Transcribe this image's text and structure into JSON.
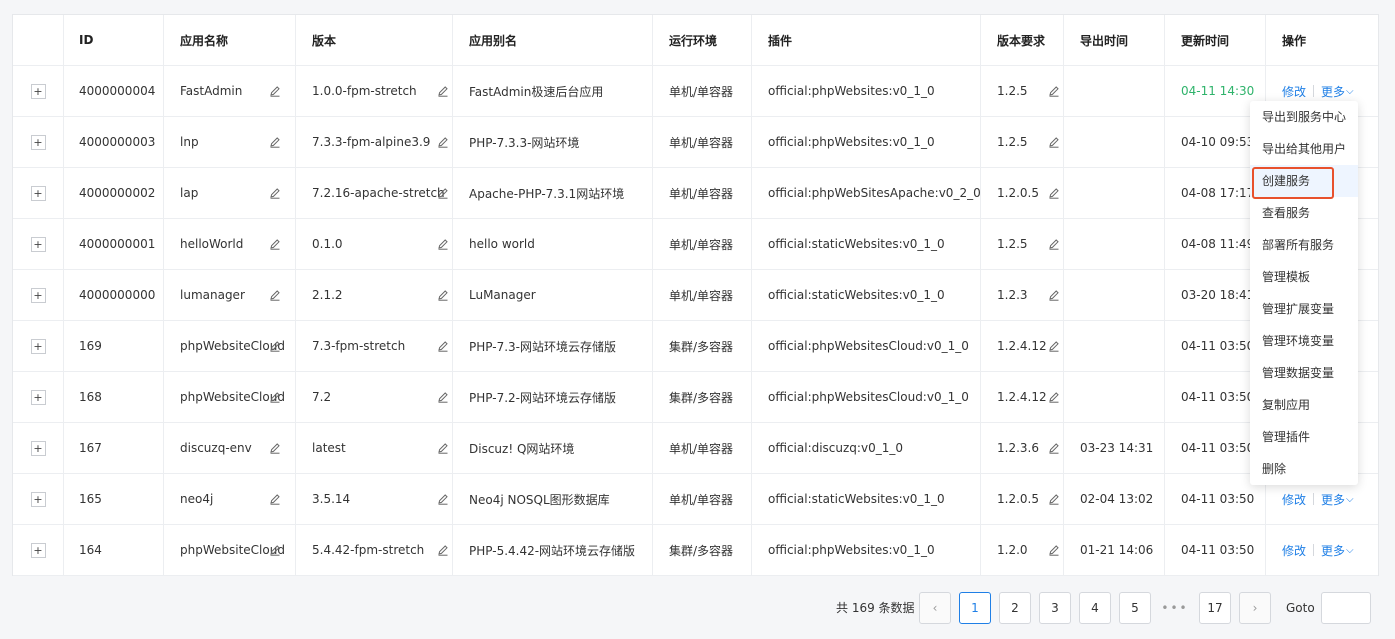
{
  "columns": [
    "",
    "ID",
    "应用名称",
    "版本",
    "应用别名",
    "运行环境",
    "插件",
    "版本要求",
    "导出时间",
    "更新时间",
    "操作"
  ],
  "rows": [
    {
      "id": "4000000004",
      "name": "FastAdmin",
      "version": "1.0.0-fpm-stretch",
      "alias": "FastAdmin极速后台应用",
      "env": "单机/单容器",
      "plugin": "official:phpWebsites:v0_1_0",
      "req": "1.2.5",
      "export": "",
      "update": "04-11 14:30",
      "update_green": true,
      "actions": true
    },
    {
      "id": "4000000003",
      "name": "lnp",
      "version": "7.3.3-fpm-alpine3.9",
      "alias": "PHP-7.3.3-网站环境",
      "env": "单机/单容器",
      "plugin": "official:phpWebsites:v0_1_0",
      "req": "1.2.5",
      "export": "",
      "update": "04-10 09:53",
      "update_green": false,
      "actions": false
    },
    {
      "id": "4000000002",
      "name": "lap",
      "version": "7.2.16-apache-stretch",
      "alias": "Apache-PHP-7.3.1网站环境",
      "env": "单机/单容器",
      "plugin": "official:phpWebSitesApache:v0_2_0",
      "req": "1.2.0.5",
      "export": "",
      "update": "04-08 17:17",
      "update_green": false,
      "actions": false
    },
    {
      "id": "4000000001",
      "name": "helloWorld",
      "version": "0.1.0",
      "alias": "hello world",
      "env": "单机/单容器",
      "plugin": "official:staticWebsites:v0_1_0",
      "req": "1.2.5",
      "export": "",
      "update": "04-08 11:49",
      "update_green": false,
      "actions": false
    },
    {
      "id": "4000000000",
      "name": "lumanager",
      "version": "2.1.2",
      "alias": "LuManager",
      "env": "单机/单容器",
      "plugin": "official:staticWebsites:v0_1_0",
      "req": "1.2.3",
      "export": "",
      "update": "03-20 18:41",
      "update_green": false,
      "actions": false
    },
    {
      "id": "169",
      "name": "phpWebsiteCloud",
      "version": "7.3-fpm-stretch",
      "alias": "PHP-7.3-网站环境云存储版",
      "env": "集群/多容器",
      "plugin": "official:phpWebsitesCloud:v0_1_0",
      "req": "1.2.4.12",
      "export": "",
      "update": "04-11 03:50",
      "update_green": false,
      "actions": false
    },
    {
      "id": "168",
      "name": "phpWebsiteCloud",
      "version": "7.2",
      "alias": "PHP-7.2-网站环境云存储版",
      "env": "集群/多容器",
      "plugin": "official:phpWebsitesCloud:v0_1_0",
      "req": "1.2.4.12",
      "export": "",
      "update": "04-11 03:50",
      "update_green": false,
      "actions": false
    },
    {
      "id": "167",
      "name": "discuzq-env",
      "version": "latest",
      "alias": "Discuz! Q网站环境",
      "env": "单机/单容器",
      "plugin": "official:discuzq:v0_1_0",
      "req": "1.2.3.6",
      "export": "03-23 14:31",
      "update": "04-11 03:50",
      "update_green": false,
      "actions": false
    },
    {
      "id": "165",
      "name": "neo4j",
      "version": "3.5.14",
      "alias": "Neo4j NOSQL图形数据库",
      "env": "单机/单容器",
      "plugin": "official:staticWebsites:v0_1_0",
      "req": "1.2.0.5",
      "export": "02-04 13:02",
      "update": "04-11 03:50",
      "update_green": false,
      "actions": true
    },
    {
      "id": "164",
      "name": "phpWebsiteCloud",
      "version": "5.4.42-fpm-stretch",
      "alias": "PHP-5.4.42-网站环境云存储版",
      "env": "集群/多容器",
      "plugin": "official:phpWebsites:v0_1_0",
      "req": "1.2.0",
      "export": "01-21 14:06",
      "update": "04-11 03:50",
      "update_green": false,
      "actions": true
    }
  ],
  "expand_symbol": "+",
  "action_edit": "修改",
  "action_more": "更多",
  "dropdown": [
    "导出到服务中心",
    "导出给其他用户",
    "创建服务",
    "查看服务",
    "部署所有服务",
    "管理模板",
    "管理扩展变量",
    "管理环境变量",
    "管理数据变量",
    "复制应用",
    "管理插件",
    "删除"
  ],
  "dropdown_active": "创建服务",
  "pagination": {
    "total": "共 169 条数据",
    "prev": "‹",
    "next": "›",
    "pages": [
      "1",
      "2",
      "3",
      "4",
      "5"
    ],
    "ellipsis": "•••",
    "last": "17",
    "current": "1",
    "goto_label": "Goto"
  },
  "colors": {
    "accent": "#1f7fe6",
    "green": "#2fb36b",
    "highlight": "#e8512d"
  }
}
